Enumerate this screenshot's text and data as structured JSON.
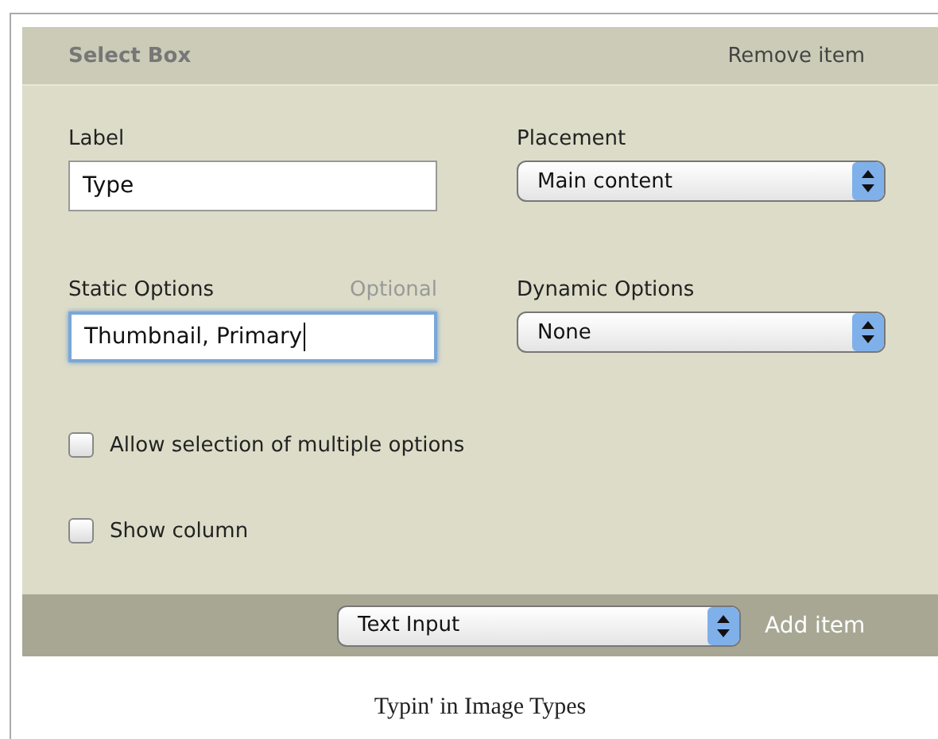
{
  "header": {
    "title": "Select Box",
    "action": "Remove item"
  },
  "fields": [
    {
      "kind": "text",
      "label": "Label",
      "value": "Type",
      "focused": false
    },
    {
      "kind": "select",
      "label": "Placement",
      "value": "Main content"
    },
    {
      "kind": "text",
      "label": "Static Options",
      "hint": "Optional",
      "value": "Thumbnail, Primary",
      "focused": true
    },
    {
      "kind": "select",
      "label": "Dynamic Options",
      "value": "None"
    }
  ],
  "checkboxes": [
    {
      "label": "Allow selection of multiple options",
      "checked": false
    },
    {
      "label": "Show column",
      "checked": false
    }
  ],
  "footer": {
    "select": "Text Input",
    "action": "Add item"
  },
  "caption": "Typin' in Image Types"
}
